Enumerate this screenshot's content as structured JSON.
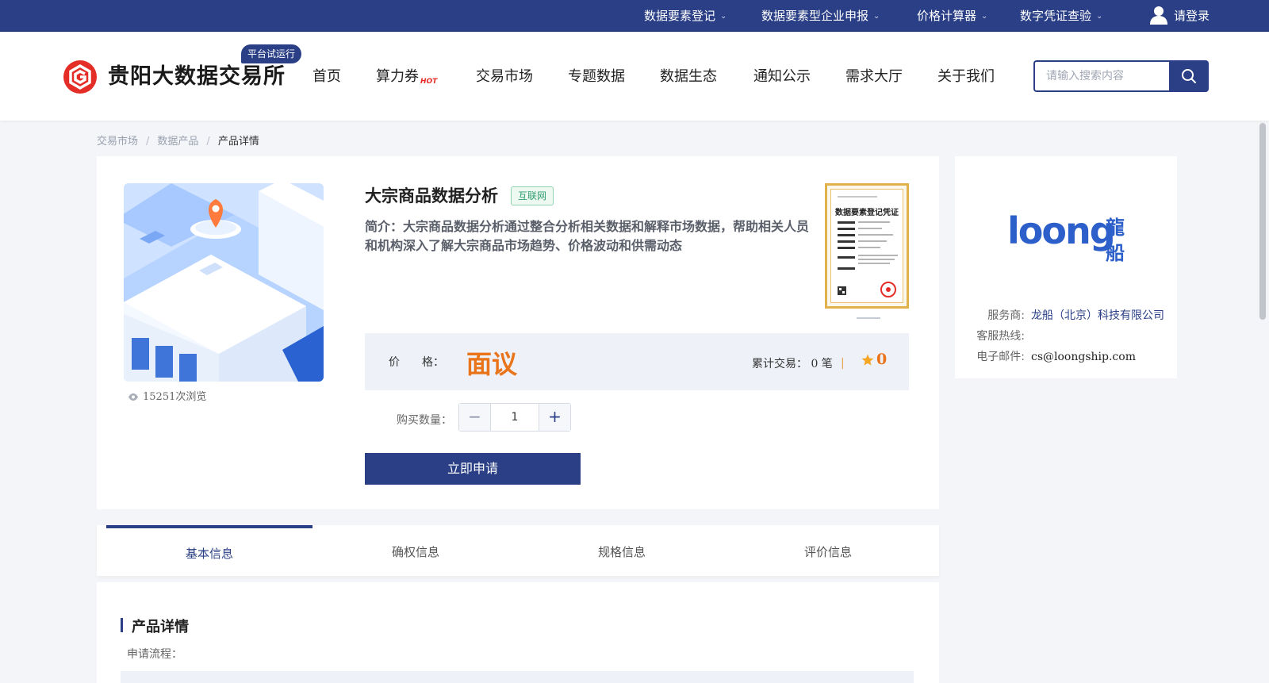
{
  "topbar": {
    "links": [
      {
        "label": "数据要素登记"
      },
      {
        "label": "数据要素型企业申报"
      },
      {
        "label": "价格计算器"
      },
      {
        "label": "数字凭证查验"
      }
    ],
    "login_label": "请登录"
  },
  "header": {
    "logo_text": "贵阳大数据交易所",
    "trial_badge": "平台试运行",
    "nav": [
      {
        "label": "首页"
      },
      {
        "label": "算力券",
        "badge": "HOT"
      },
      {
        "label": "交易市场"
      },
      {
        "label": "专题数据"
      },
      {
        "label": "数据生态"
      },
      {
        "label": "通知公示"
      },
      {
        "label": "需求大厅"
      },
      {
        "label": "关于我们"
      }
    ],
    "search_placeholder": "请输入搜索内容"
  },
  "breadcrumb": {
    "items": [
      "交易市场",
      "数据产品"
    ],
    "current": "产品详情",
    "separator": "/"
  },
  "product": {
    "title": "大宗商品数据分析",
    "tag": "互联网",
    "intro": "简介：大宗商品数据分析通过整合分析相关数据和解释市场数据，帮助相关人员和机构深入了解大宗商品市场趋势、价格波动和供需动态",
    "views": "15251次浏览",
    "certificate_title": "数据要素登记凭证",
    "price_label": "价　　格：",
    "price_value": "面议",
    "trade_count": "累计交易：  0 笔",
    "divider": "|",
    "rating": "0",
    "qty_label": "购买数量：",
    "qty_value": "1",
    "minus_symbol": "−",
    "plus_symbol": "+",
    "apply_label": "立即申请"
  },
  "vendor": {
    "logo_latin": "loong",
    "logo_cn_top": "龍",
    "logo_cn_bottom": "船",
    "provider_label": "服务商:",
    "provider_value": "龙船（北京）科技有限公司",
    "hotline_label": "客服热线:",
    "hotline_value": "",
    "email_label": "电子邮件:",
    "email_value": "cs@loongship.com"
  },
  "tabs": [
    {
      "label": "基本信息",
      "active": true
    },
    {
      "label": "确权信息",
      "active": false
    },
    {
      "label": "规格信息",
      "active": false
    },
    {
      "label": "评价信息",
      "active": false
    }
  ],
  "details": {
    "section_title": "产品详情",
    "process_label": "申请流程："
  },
  "colors": {
    "brand": "#2a3f86",
    "accent_orange": "#e9741a",
    "logo_red": "#e52d27",
    "tag_green": "#2f9f6e"
  },
  "icons": {
    "search": "search-icon",
    "user": "user-icon",
    "eye": "eye-icon",
    "star": "star-icon",
    "chevron": "chevron-down-icon"
  }
}
